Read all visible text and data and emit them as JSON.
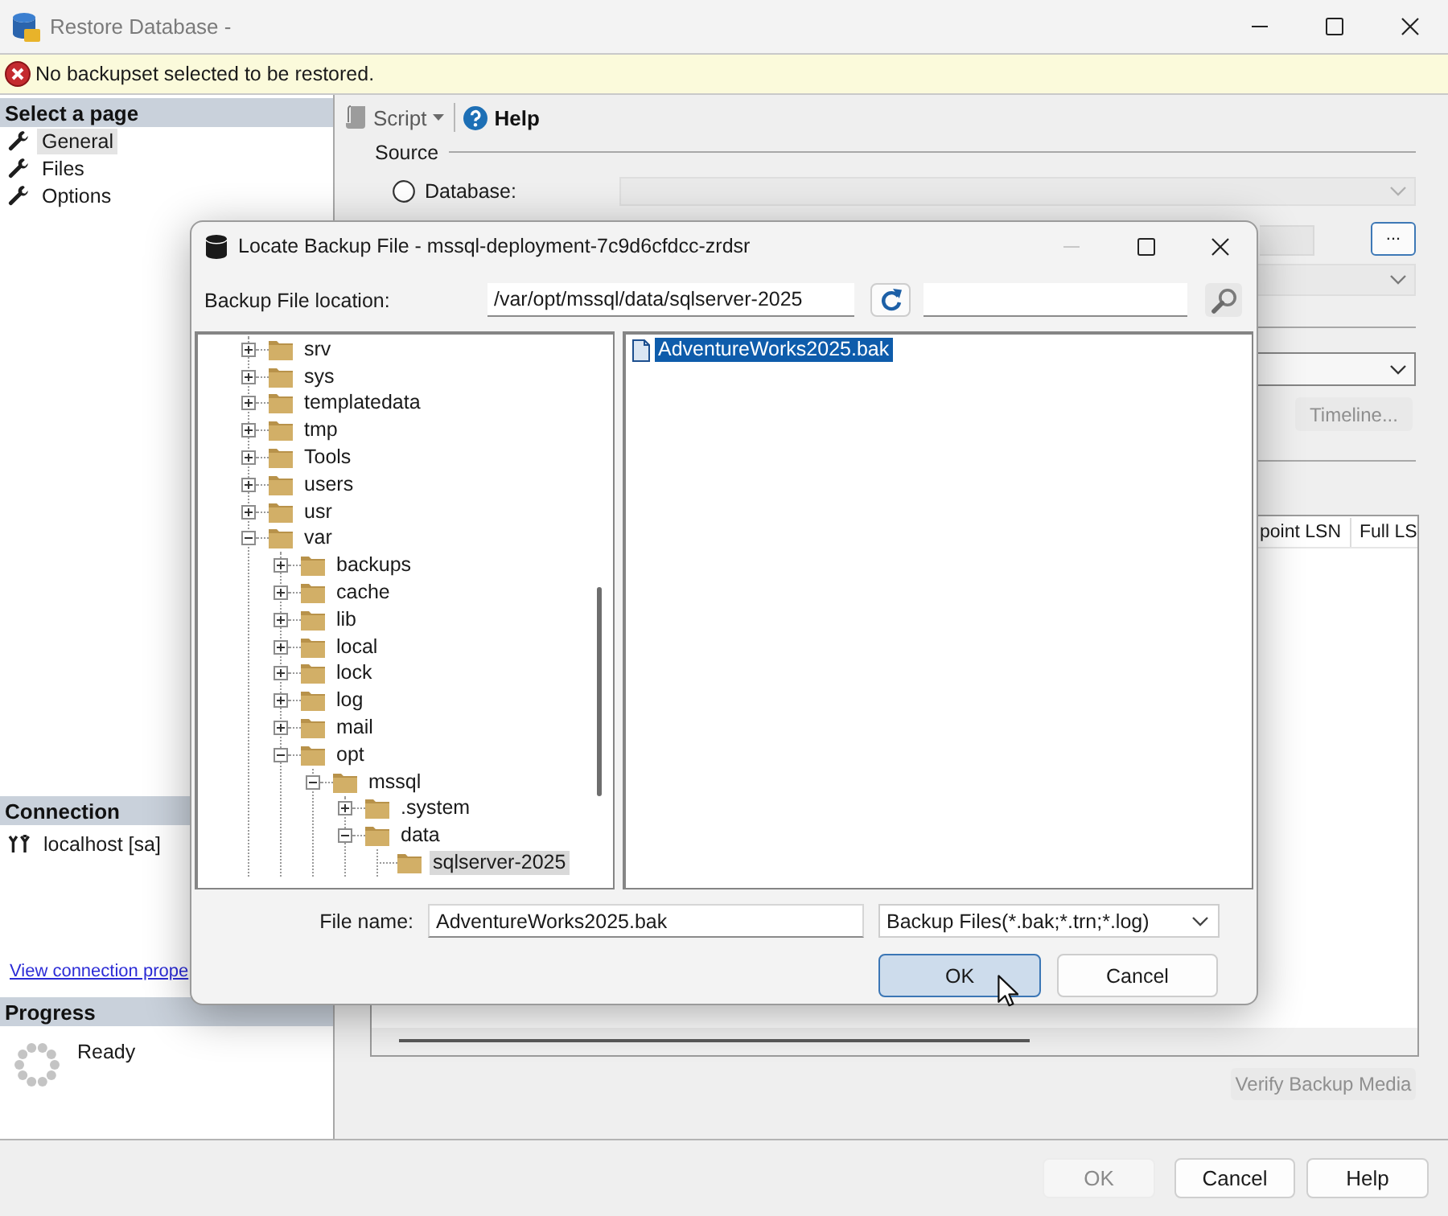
{
  "window": {
    "title": "Restore Database -",
    "controls": [
      {
        "kind": "minimize",
        "disabled": false
      },
      {
        "kind": "maximize",
        "disabled": false
      },
      {
        "kind": "close",
        "disabled": false
      }
    ]
  },
  "message": {
    "kind": "error",
    "text": "No backupset selected to be restored."
  },
  "sidebar": {
    "pages_header": "Select a page",
    "pages": [
      {
        "label": "General",
        "selected": true
      },
      {
        "label": "Files",
        "selected": false
      },
      {
        "label": "Options",
        "selected": false
      }
    ],
    "connection_header": "Connection",
    "connection": "localhost [sa]",
    "connection_link": "View connection prope",
    "progress_header": "Progress",
    "progress_status": "Ready"
  },
  "toolbar": {
    "script": "Script",
    "help": "Help"
  },
  "source": {
    "label": "Source",
    "options": [
      {
        "label": "Database:",
        "selected": false
      }
    ],
    "browse_button": "..."
  },
  "timeline_button": {
    "label": "Timeline...",
    "disabled": true
  },
  "backup_sets": {
    "columns": [
      "point LSN",
      "Full LS"
    ]
  },
  "verify_button": {
    "label": "Verify Backup Media",
    "disabled": true
  },
  "buttons": [
    {
      "label": "OK",
      "disabled": true
    },
    {
      "label": "Cancel",
      "disabled": false
    },
    {
      "label": "Help",
      "disabled": false
    }
  ],
  "dialog": {
    "title": "Locate Backup File - mssql-deployment-7c9d6cfdcc-zrdsr",
    "controls": [
      {
        "kind": "minimize",
        "disabled": true
      },
      {
        "kind": "maximize",
        "disabled": false
      },
      {
        "kind": "close",
        "disabled": false
      }
    ],
    "location_label": "Backup File location:",
    "location": "/var/opt/mssql/data/sqlserver-2025",
    "tree": [
      {
        "label": "srv",
        "expandable": true,
        "expanded": false,
        "selected": false
      },
      {
        "label": "sys",
        "expandable": true,
        "expanded": false,
        "selected": false
      },
      {
        "label": "templatedata",
        "expandable": true,
        "expanded": false,
        "selected": false
      },
      {
        "label": "tmp",
        "expandable": true,
        "expanded": false,
        "selected": false
      },
      {
        "label": "Tools",
        "expandable": true,
        "expanded": false,
        "selected": false
      },
      {
        "label": "users",
        "expandable": true,
        "expanded": false,
        "selected": false
      },
      {
        "label": "usr",
        "expandable": true,
        "expanded": false,
        "selected": false
      },
      {
        "label": "var",
        "expandable": true,
        "expanded": true,
        "selected": false,
        "children": [
          {
            "label": "backups",
            "expandable": true,
            "expanded": false,
            "selected": false
          },
          {
            "label": "cache",
            "expandable": true,
            "expanded": false,
            "selected": false
          },
          {
            "label": "lib",
            "expandable": true,
            "expanded": false,
            "selected": false
          },
          {
            "label": "local",
            "expandable": true,
            "expanded": false,
            "selected": false
          },
          {
            "label": "lock",
            "expandable": true,
            "expanded": false,
            "selected": false
          },
          {
            "label": "log",
            "expandable": true,
            "expanded": false,
            "selected": false
          },
          {
            "label": "mail",
            "expandable": true,
            "expanded": false,
            "selected": false
          },
          {
            "label": "opt",
            "expandable": true,
            "expanded": true,
            "selected": false,
            "children": [
              {
                "label": "mssql",
                "expandable": true,
                "expanded": true,
                "selected": false,
                "children": [
                  {
                    "label": ".system",
                    "expandable": true,
                    "expanded": false,
                    "selected": false
                  },
                  {
                    "label": "data",
                    "expandable": true,
                    "expanded": true,
                    "selected": false,
                    "children": [
                      {
                        "label": "sqlserver-2025",
                        "expandable": false,
                        "selected": true
                      }
                    ]
                  }
                ]
              }
            ]
          }
        ]
      }
    ],
    "files": [
      {
        "name": "AdventureWorks2025.bak",
        "selected": true
      }
    ],
    "file_name_label": "File name:",
    "file_name": "AdventureWorks2025.bak",
    "file_type": "Backup Files(*.bak;*.trn;*.log)",
    "buttons": [
      {
        "label": "OK",
        "focused": true
      },
      {
        "label": "Cancel",
        "focused": false
      }
    ]
  }
}
